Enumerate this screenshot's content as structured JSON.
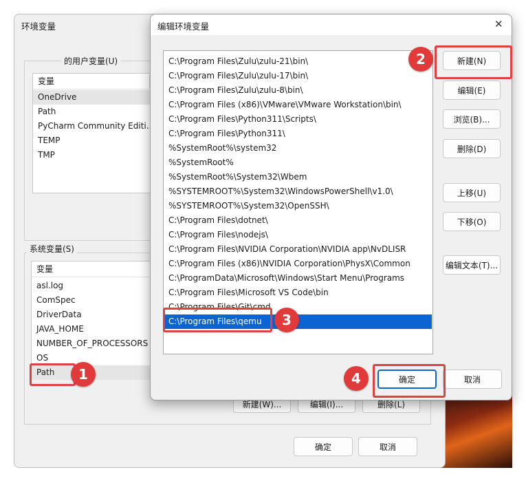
{
  "bg_window": {
    "title": "环境变量",
    "user_group_label": "的用户变量(U)",
    "user_col_header": "变量",
    "user_vars": [
      "OneDrive",
      "Path",
      "PyCharm Community Editi...",
      "TEMP",
      "TMP"
    ],
    "system_group_label": "系统变量(S)",
    "system_col_header": "变量",
    "system_vars": [
      "asl.log",
      "ComSpec",
      "DriverData",
      "JAVA_HOME",
      "NUMBER_OF_PROCESSORS",
      "OS",
      "Path"
    ],
    "sys_buttons": [
      "新建(W)...",
      "编辑(I)...",
      "删除(L)"
    ],
    "ok_label": "确定",
    "cancel_label": "取消"
  },
  "dialog": {
    "title": "编辑环境变量",
    "close_glyph": "✕",
    "paths": [
      "C:\\Program Files\\Zulu\\zulu-21\\bin\\",
      "C:\\Program Files\\Zulu\\zulu-17\\bin\\",
      "C:\\Program Files\\Zulu\\zulu-8\\bin\\",
      "C:\\Program Files (x86)\\VMware\\VMware Workstation\\bin\\",
      "C:\\Program Files\\Python311\\Scripts\\",
      "C:\\Program Files\\Python311\\",
      "%SystemRoot%\\system32",
      "%SystemRoot%",
      "%SystemRoot%\\System32\\Wbem",
      "%SYSTEMROOT%\\System32\\WindowsPowerShell\\v1.0\\",
      "%SYSTEMROOT%\\System32\\OpenSSH\\",
      "C:\\Program Files\\dotnet\\",
      "C:\\Program Files\\nodejs\\",
      "C:\\Program Files\\NVIDIA Corporation\\NVIDIA app\\NvDLISR",
      "C:\\Program Files (x86)\\NVIDIA Corporation\\PhysX\\Common",
      "C:\\ProgramData\\Microsoft\\Windows\\Start Menu\\Programs",
      "C:\\Program Files\\Microsoft VS Code\\bin",
      "C:\\Program Files\\Git\\cmd",
      "C:\\Program Files\\qemu"
    ],
    "selected_index": 18,
    "buttons": {
      "new": "新建(N)",
      "edit": "编辑(E)",
      "browse": "浏览(B)...",
      "delete": "删除(D)",
      "move_up": "上移(U)",
      "move_down": "下移(O)",
      "edit_text": "编辑文本(T)..."
    },
    "ok_label": "确定",
    "cancel_label": "取消"
  },
  "annotations": [
    "1",
    "2",
    "3",
    "4"
  ],
  "colors": {
    "selection": "#0a64d2",
    "annotation": "#e03a3a",
    "hover_row": "#e5e5e5"
  }
}
